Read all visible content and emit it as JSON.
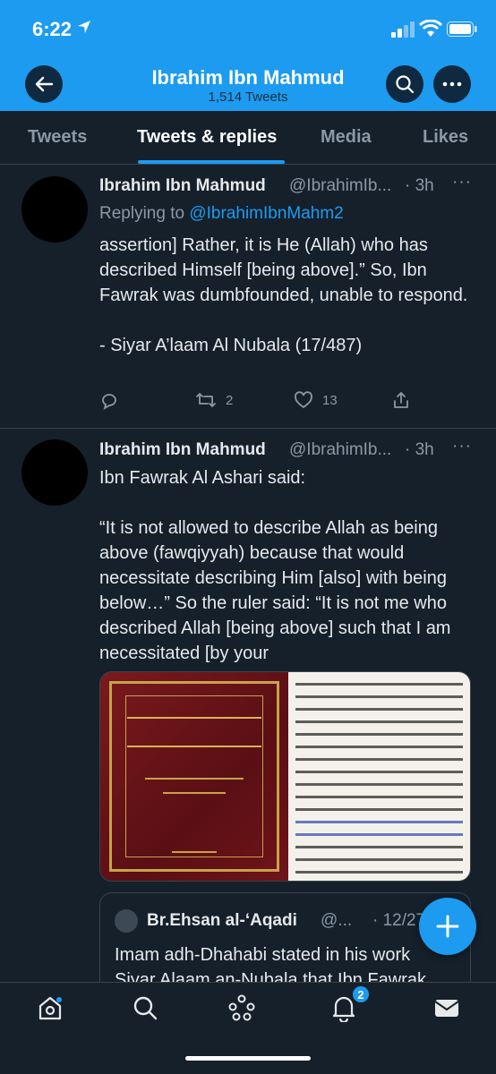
{
  "status_bar": {
    "time": "6:22"
  },
  "profile": {
    "name": "Ibrahim Ibn Mahmud",
    "tweet_count": "1,514 Tweets"
  },
  "tabs": [
    {
      "label": "Tweets"
    },
    {
      "label": "Tweets & replies"
    },
    {
      "label": "Media"
    },
    {
      "label": "Likes"
    }
  ],
  "active_tab": "Tweets & replies",
  "tweets": [
    {
      "name": "Ibrahim Ibn Mahmud",
      "handle": "@IbrahimIb...",
      "time": "· 3h",
      "replying_prefix": "Replying to ",
      "replying_to": "@IbrahimIbnMahm2",
      "text": "assertion] Rather, it is He (Allah) who has described Himself [being above].” So, Ibn Fawrak was dumbfounded, unable to respond.\n\n- Siyar A’laam Al Nubala (17/487)",
      "retweets": "2",
      "likes": "13"
    },
    {
      "name": "Ibrahim Ibn Mahmud",
      "handle": "@IbrahimIb...",
      "time": "· 3h",
      "text": "Ibn Fawrak Al Ashari said:\n\n“It is not allowed to describe Allah as being above (fawqiyyah) because that would necessitate describing Him [also] with being below…” So the ruler said: “It is not me who described Allah [being above] such that I am necessitated [by your",
      "quoted": {
        "name": "Br.Ehsan al-‘Aqadi",
        "handle": "@...",
        "date": "· 12/27",
        "text_line1": "Imam adh-Dhahabi stated in his work",
        "text_line2": "Siyar Alaam an-Nubala that Ibn Fawrak"
      }
    }
  ],
  "notifications_badge": "2",
  "icons": {
    "back": "back-arrow-icon",
    "search": "search-icon",
    "more": "more-icon",
    "compose": "plus-icon",
    "nav": [
      "home-icon",
      "search-icon",
      "spaces-icon",
      "bell-icon",
      "mail-icon"
    ]
  },
  "colors": {
    "accent": "#1d9bf0",
    "background": "#15202b"
  }
}
